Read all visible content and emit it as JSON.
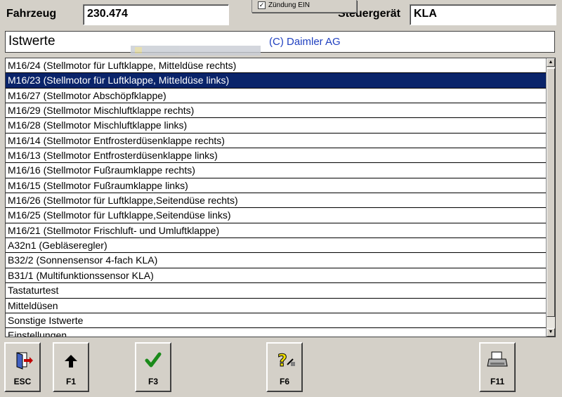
{
  "header": {
    "vehicle_label": "Fahrzeug",
    "vehicle_value": "230.474",
    "ecu_label": "Steuergerät",
    "ecu_value": "KLA",
    "ignition_popup": "Zündung EIN"
  },
  "panel": {
    "title": "Istwerte",
    "copyright": "(C) Daimler AG"
  },
  "list": {
    "selected_index": 1,
    "items": [
      "M16/24 (Stellmotor für Luftklappe, Mitteldüse rechts)",
      "M16/23 (Stellmotor für Luftklappe, Mitteldüse links)",
      "M16/27 (Stellmotor Abschöpfklappe)",
      "M16/29 (Stellmotor Mischluftklappe rechts)",
      "M16/28 (Stellmotor Mischluftklappe links)",
      "M16/14 (Stellmotor Entfrosterdüsenklappe rechts)",
      "M16/13 (Stellmotor Entfrosterdüsenklappe links)",
      "M16/16 (Stellmotor Fußraumklappe rechts)",
      "M16/15 (Stellmotor Fußraumklappe links)",
      "M16/26 (Stellmotor für Luftklappe,Seitendüse rechts)",
      "M16/25 (Stellmotor für Luftklappe,Seitendüse links)",
      "M16/21 (Stellmotor Frischluft- und Umluftklappe)",
      "A32n1 (Gebläseregler)",
      "B32/2 (Sonnensensor 4-fach KLA)",
      "B31/1 (Multifunktionssensor KLA)",
      "Tastaturtest",
      "Mitteldüsen",
      "Sonstige Istwerte",
      "Einstellungen"
    ]
  },
  "toolbar": {
    "esc": {
      "label": "ESC",
      "icon": "exit-door-icon"
    },
    "f1": {
      "label": "F1",
      "icon": "arrow-up-icon"
    },
    "f3": {
      "label": "F3",
      "icon": "checkmark-icon"
    },
    "f6": {
      "label": "F6",
      "icon": "help-question-icon"
    },
    "f11": {
      "label": "F11",
      "icon": "printer-icon"
    }
  },
  "colors": {
    "background": "#d4d0c8",
    "selection": "#0a246a",
    "copyright_text": "#2040c0"
  }
}
